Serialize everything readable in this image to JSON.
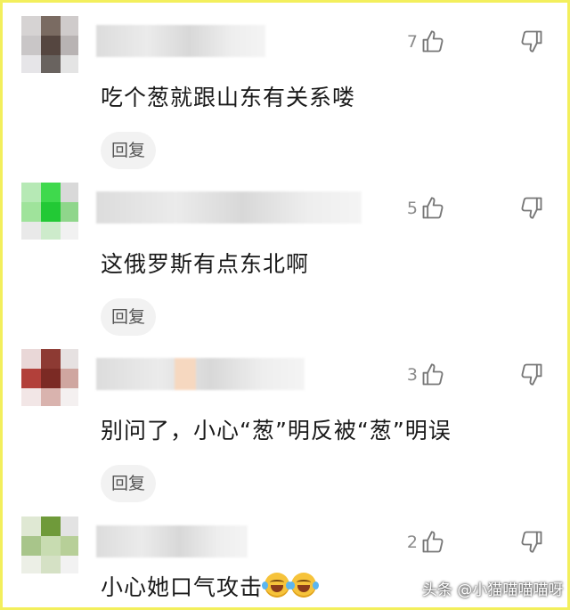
{
  "comments": [
    {
      "like_count": "7",
      "text": "吃个葱就跟山东有关系喽",
      "reply_label": "回复"
    },
    {
      "like_count": "5",
      "text": "这俄罗斯有点东北啊",
      "reply_label": "回复"
    },
    {
      "like_count": "3",
      "text": "别问了，小心“葱”明反被“葱”明误",
      "reply_label": "回复"
    },
    {
      "like_count": "2",
      "text": "小心她口气攻击"
    }
  ],
  "watermark": "头条 @小猫喵喵喵呀",
  "colors": {
    "border": "#f3ef5c",
    "reply_bg": "#f2f2f2",
    "count": "#8a8a8a"
  },
  "icons": {
    "like": "thumbs-up-icon",
    "dislike": "thumbs-down-icon",
    "emoji": "laughing-crying-emoji-icon"
  }
}
